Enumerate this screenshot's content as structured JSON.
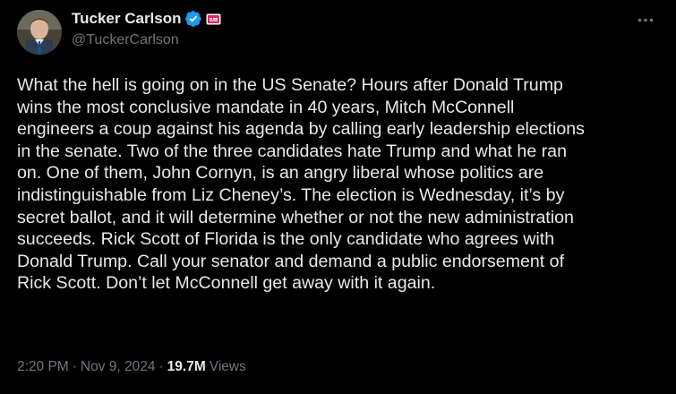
{
  "author": {
    "display_name": "Tucker Carlson",
    "handle": "@TuckerCarlson",
    "avatar_icon": "profile-photo",
    "verified_icon": "verified-badge-icon",
    "affiliate_icon": "affiliate-badge-icon",
    "verified_color": "#1d9bf0",
    "affiliate_color": "#e0245e"
  },
  "menu": {
    "more_icon": "more-options-icon"
  },
  "tweet": {
    "text": "What the hell is going on in the US Senate? Hours after Donald Trump\nwins the most conclusive mandate in 40 years, Mitch McConnell\nengineers a coup against his agenda by calling early leadership elections\nin the senate. Two of the three candidates hate Trump and what he ran\non. One of them, John Cornyn, is an angry liberal whose politics are\nindistinguishable from Liz Cheney’s. The election is Wednesday, it’s by\nsecret ballot, and it will determine whether or not the new administration\nsucceeds. Rick Scott of Florida is the only candidate who agrees with\nDonald Trump. Call your senator and demand a public endorsement of\nRick Scott. Don’t let McConnell get away with it again."
  },
  "meta": {
    "time": "2:20 PM",
    "separator": "·",
    "date": "Nov 9, 2024",
    "views_count": "19.7M",
    "views_label": "Views"
  },
  "colors": {
    "background": "#000000",
    "text": "#e7e9ea",
    "secondary": "#71767b"
  }
}
